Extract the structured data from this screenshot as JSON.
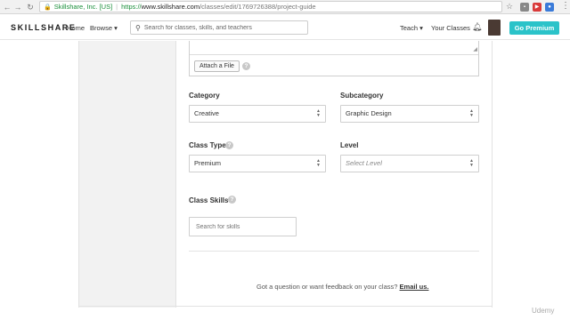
{
  "browser": {
    "site_name": "Skillshare, Inc. [US]",
    "url_scheme": "https://",
    "url_host": "www.skillshare.com",
    "url_path": "/classes/edit/1769726388/project-guide"
  },
  "header": {
    "logo": "SKILLSHARE",
    "home": "Home",
    "browse": "Browse ▾",
    "search_placeholder": "Search for classes, skills, and teachers",
    "teach": "Teach ▾",
    "your_classes": "Your Classes",
    "go_premium": "Go Premium",
    "accent_color": "#2bc3c9"
  },
  "form": {
    "attach_label": "Attach a File",
    "category_label": "Category",
    "category_value": "Creative",
    "subcategory_label": "Subcategory",
    "subcategory_value": "Graphic Design",
    "class_type_label": "Class Type",
    "class_type_value": "Premium",
    "level_label": "Level",
    "level_placeholder": "Select Level",
    "class_skills_label": "Class Skills",
    "skills_placeholder": "Search for skills",
    "help_icon": "?"
  },
  "footer": {
    "question": "Got a question or want feedback on your class?",
    "email_link": "Email us."
  },
  "watermark": "Udemy"
}
